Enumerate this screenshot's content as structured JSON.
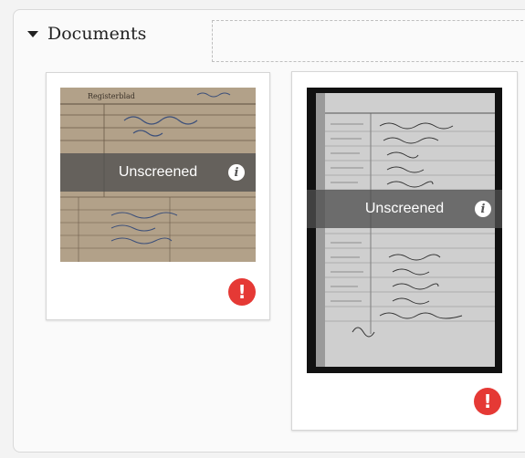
{
  "section": {
    "title": "Documents",
    "expand_icon": "caret-down-icon"
  },
  "documents": [
    {
      "status_label": "Unscreened",
      "info_icon": "info-icon",
      "alert_icon": "exclamation-alert-icon",
      "info_glyph": "i",
      "alert_glyph": "!",
      "thumb_handwriting": "Registerblad"
    },
    {
      "status_label": "Unscreened",
      "info_icon": "info-icon",
      "alert_icon": "exclamation-alert-icon",
      "info_glyph": "i",
      "alert_glyph": "!"
    }
  ],
  "colors": {
    "alert": "#e53935",
    "overlay": "#505050",
    "doc1_paper": "#b8a78f",
    "doc2_background": "#111111"
  }
}
